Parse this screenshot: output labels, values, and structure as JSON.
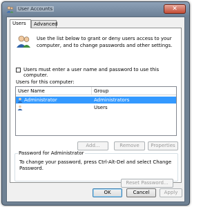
{
  "window": {
    "title": "User Accounts",
    "close_glyph": "✕"
  },
  "tabs": [
    {
      "label": "Users",
      "active": true
    },
    {
      "label": "Advanced",
      "active": false
    }
  ],
  "description": "Use the list below to grant or deny users access to your computer, and to change passwords and other settings.",
  "must_login_checkbox": {
    "label": "Users must enter a user name and password to use this computer.",
    "checked": false
  },
  "users_list": {
    "label": "Users for this computer:",
    "columns": [
      "User Name",
      "Group"
    ],
    "rows": [
      {
        "name": "Administrator",
        "group": "Administrators",
        "selected": true
      },
      {
        "name": "",
        "group": "Users",
        "selected": false
      }
    ]
  },
  "list_buttons": {
    "add": "Add...",
    "remove": "Remove",
    "properties": "Properties"
  },
  "password_group": {
    "title": "Password for Administrator",
    "text": "To change your password, press Ctrl-Alt-Del and select Change Password.",
    "reset_button": "Reset Password..."
  },
  "dialog_buttons": {
    "ok": "OK",
    "cancel": "Cancel",
    "apply": "Apply"
  },
  "colors": {
    "selection": "#3399ff",
    "title_bar": "#6c8096",
    "close_button": "#c44c36"
  }
}
